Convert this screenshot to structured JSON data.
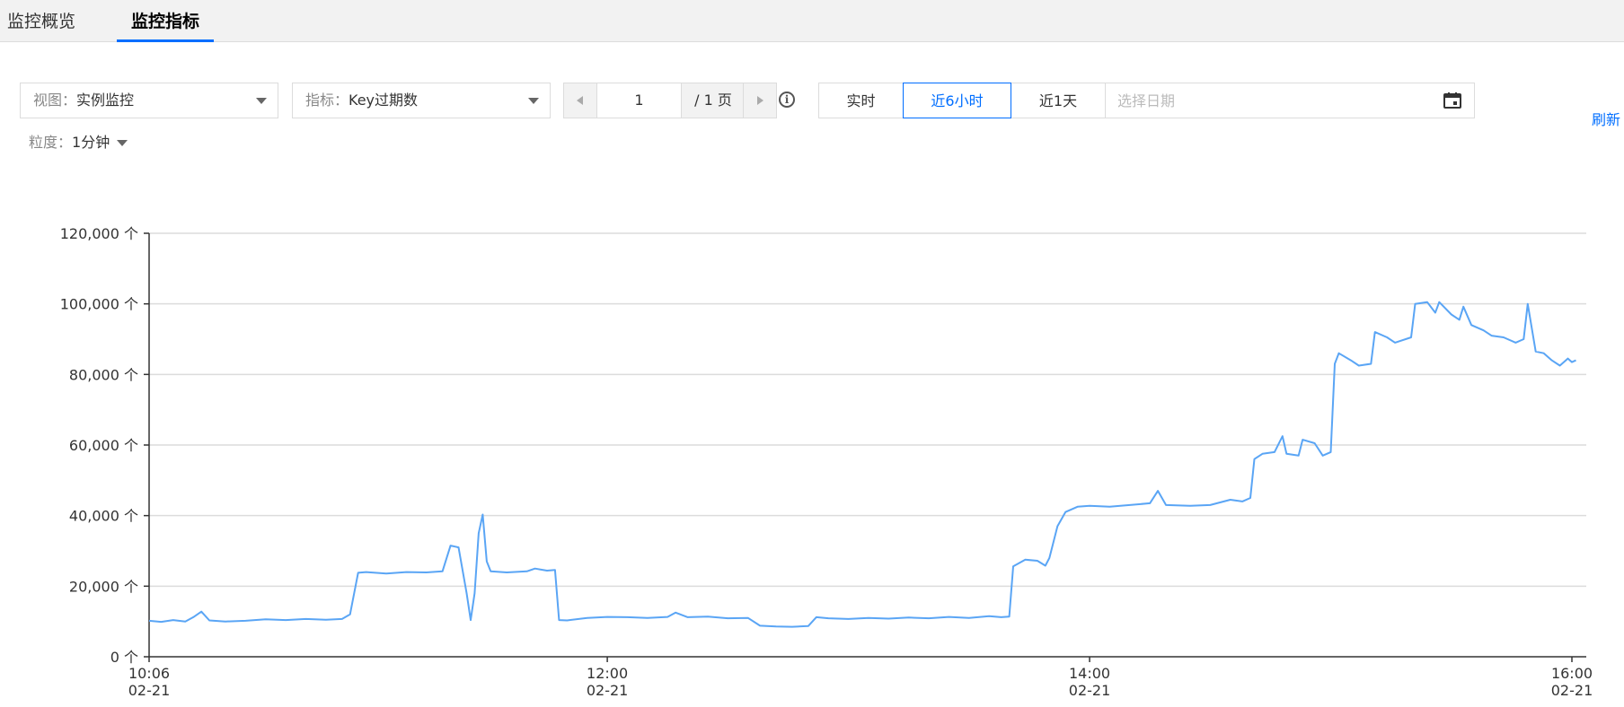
{
  "tabs": [
    {
      "label": "监控概览"
    },
    {
      "label": "监控指标"
    }
  ],
  "view_select": {
    "label": "视图：",
    "value": "实例监控"
  },
  "metric_select": {
    "label": "指标：",
    "value": "Key过期数"
  },
  "pager": {
    "current": "1",
    "total": "/ 1 页"
  },
  "time_range": {
    "buttons": [
      "实时",
      "近6小时",
      "近1天"
    ],
    "active": "近6小时",
    "date_placeholder": "选择日期"
  },
  "refresh_label": "刷新",
  "granularity": {
    "label": "粒度：",
    "value": "1分钟"
  },
  "colors": {
    "accent": "#006eff",
    "line": "#5aa5f5"
  },
  "chart_data": {
    "type": "line",
    "y_unit": "个",
    "ylim": [
      0,
      120000
    ],
    "yticks": [
      0,
      20000,
      40000,
      60000,
      80000,
      100000,
      120000
    ],
    "ytick_labels": [
      "0 个",
      "20,000 个",
      "40,000 个",
      "60,000 个",
      "80,000 个",
      "100,000 个",
      "120,000 个"
    ],
    "xlim": [
      "10:06",
      "16:00"
    ],
    "xticks": [
      {
        "time": "10:06",
        "date": "02-21"
      },
      {
        "time": "12:00",
        "date": "02-21"
      },
      {
        "time": "14:00",
        "date": "02-21"
      },
      {
        "time": "16:00",
        "date": "02-21"
      }
    ],
    "grid": true,
    "series": [
      {
        "values": [
          [
            "10:06",
            10200
          ],
          [
            "10:09",
            9900
          ],
          [
            "10:12",
            10400
          ],
          [
            "10:15",
            10000
          ],
          [
            "10:17",
            11200
          ],
          [
            "10:19",
            12800
          ],
          [
            "10:21",
            10300
          ],
          [
            "10:25",
            10000
          ],
          [
            "10:30",
            10200
          ],
          [
            "10:35",
            10600
          ],
          [
            "10:40",
            10400
          ],
          [
            "10:45",
            10700
          ],
          [
            "10:50",
            10500
          ],
          [
            "10:54",
            10700
          ],
          [
            "10:56",
            12000
          ],
          [
            "10:58",
            23800
          ],
          [
            "11:00",
            24000
          ],
          [
            "11:05",
            23600
          ],
          [
            "11:10",
            24000
          ],
          [
            "11:15",
            23900
          ],
          [
            "11:19",
            24200
          ],
          [
            "11:21",
            31500
          ],
          [
            "11:23",
            31000
          ],
          [
            "11:25",
            18000
          ],
          [
            "11:26",
            10400
          ],
          [
            "11:27",
            18000
          ],
          [
            "11:28",
            35000
          ],
          [
            "11:29",
            40300
          ],
          [
            "11:30",
            27000
          ],
          [
            "11:31",
            24200
          ],
          [
            "11:35",
            23900
          ],
          [
            "11:40",
            24200
          ],
          [
            "11:42",
            25000
          ],
          [
            "11:45",
            24400
          ],
          [
            "11:47",
            24600
          ],
          [
            "11:48",
            10400
          ],
          [
            "11:50",
            10300
          ],
          [
            "11:55",
            11000
          ],
          [
            "12:00",
            11300
          ],
          [
            "12:05",
            11200
          ],
          [
            "12:10",
            11000
          ],
          [
            "12:15",
            11300
          ],
          [
            "12:17",
            12500
          ],
          [
            "12:20",
            11200
          ],
          [
            "12:25",
            11400
          ],
          [
            "12:30",
            10900
          ],
          [
            "12:35",
            11000
          ],
          [
            "12:38",
            8800
          ],
          [
            "12:42",
            8600
          ],
          [
            "12:46",
            8500
          ],
          [
            "12:50",
            8700
          ],
          [
            "12:52",
            11200
          ],
          [
            "12:55",
            10900
          ],
          [
            "13:00",
            10700
          ],
          [
            "13:05",
            11000
          ],
          [
            "13:10",
            10800
          ],
          [
            "13:15",
            11100
          ],
          [
            "13:20",
            10900
          ],
          [
            "13:25",
            11300
          ],
          [
            "13:30",
            11000
          ],
          [
            "13:35",
            11500
          ],
          [
            "13:38",
            11200
          ],
          [
            "13:40",
            11400
          ],
          [
            "13:41",
            25600
          ],
          [
            "13:44",
            27500
          ],
          [
            "13:47",
            27200
          ],
          [
            "13:49",
            25800
          ],
          [
            "13:50",
            28000
          ],
          [
            "13:52",
            37000
          ],
          [
            "13:54",
            41000
          ],
          [
            "13:57",
            42500
          ],
          [
            "14:00",
            42800
          ],
          [
            "14:05",
            42500
          ],
          [
            "14:10",
            43000
          ],
          [
            "14:15",
            43500
          ],
          [
            "14:17",
            47000
          ],
          [
            "14:19",
            43000
          ],
          [
            "14:25",
            42800
          ],
          [
            "14:30",
            43000
          ],
          [
            "14:35",
            44500
          ],
          [
            "14:38",
            44000
          ],
          [
            "14:40",
            45000
          ],
          [
            "14:41",
            56000
          ],
          [
            "14:43",
            57500
          ],
          [
            "14:46",
            58000
          ],
          [
            "14:48",
            62500
          ],
          [
            "14:49",
            57500
          ],
          [
            "14:52",
            57000
          ],
          [
            "14:53",
            61500
          ],
          [
            "14:56",
            60500
          ],
          [
            "14:58",
            57000
          ],
          [
            "15:00",
            58000
          ],
          [
            "15:01",
            83000
          ],
          [
            "15:02",
            86000
          ],
          [
            "15:05",
            84000
          ],
          [
            "15:07",
            82500
          ],
          [
            "15:10",
            83000
          ],
          [
            "15:11",
            92000
          ],
          [
            "15:14",
            90500
          ],
          [
            "15:16",
            89000
          ],
          [
            "15:20",
            90500
          ],
          [
            "15:21",
            100000
          ],
          [
            "15:24",
            100500
          ],
          [
            "15:26",
            97500
          ],
          [
            "15:27",
            100500
          ],
          [
            "15:30",
            97000
          ],
          [
            "15:32",
            95500
          ],
          [
            "15:33",
            99200
          ],
          [
            "15:35",
            94000
          ],
          [
            "15:38",
            92500
          ],
          [
            "15:40",
            91000
          ],
          [
            "15:43",
            90500
          ],
          [
            "15:46",
            89000
          ],
          [
            "15:48",
            90000
          ],
          [
            "15:49",
            100000
          ],
          [
            "15:51",
            86500
          ],
          [
            "15:53",
            86000
          ],
          [
            "15:55",
            84000
          ],
          [
            "15:57",
            82500
          ],
          [
            "15:59",
            84500
          ],
          [
            "16:00",
            83500
          ],
          [
            "16:01",
            84000
          ]
        ]
      }
    ]
  }
}
